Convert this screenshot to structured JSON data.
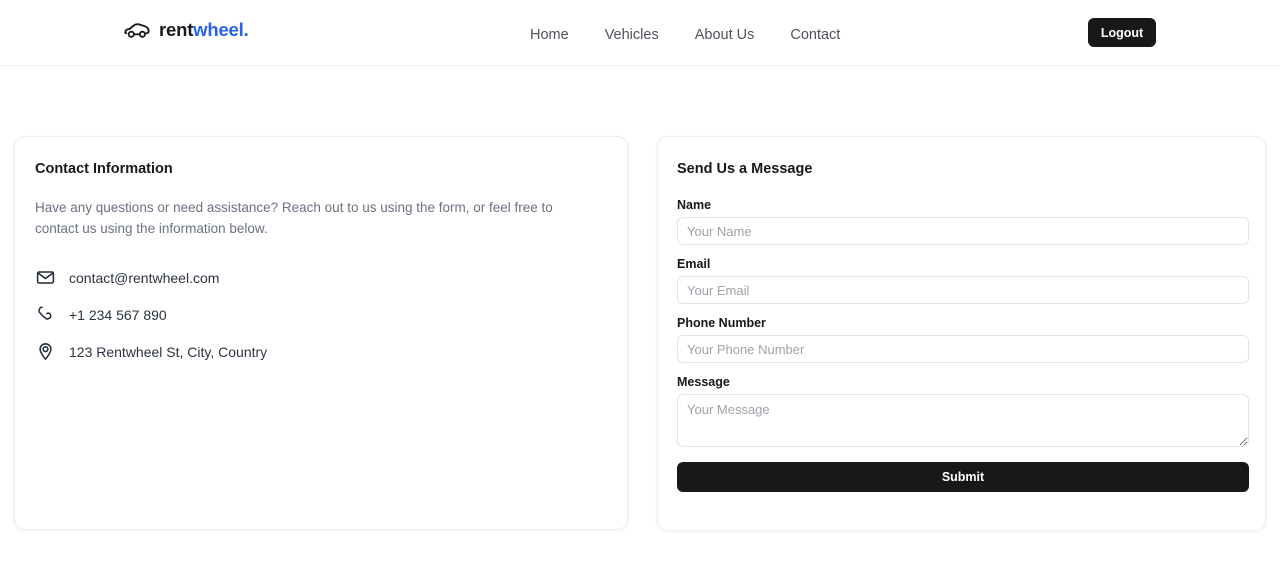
{
  "header": {
    "brand": {
      "icon": "car-icon",
      "text_primary": "rent",
      "text_accent": "wheel.",
      "accent_color": "#2563eb"
    },
    "nav": [
      {
        "label": "Home"
      },
      {
        "label": "Vehicles"
      },
      {
        "label": "About Us"
      },
      {
        "label": "Contact"
      }
    ],
    "logout_label": "Logout"
  },
  "contact_card": {
    "title": "Contact Information",
    "description": "Have any questions or need assistance? Reach out to us using the form, or feel free to contact us using the information below.",
    "details": [
      {
        "icon": "mail-icon",
        "value": "contact@rentwheel.com"
      },
      {
        "icon": "phone-icon",
        "value": "+1 234 567 890"
      },
      {
        "icon": "map-pin-icon",
        "value": "123 Rentwheel St, City, Country"
      }
    ]
  },
  "form_card": {
    "title": "Send Us a Message",
    "fields": [
      {
        "label": "Name",
        "placeholder": "Your Name",
        "value": ""
      },
      {
        "label": "Email",
        "placeholder": "Your Email",
        "value": ""
      },
      {
        "label": "Phone Number",
        "placeholder": "Your Phone Number",
        "value": ""
      },
      {
        "label": "Message",
        "placeholder": "Your Message",
        "value": ""
      }
    ],
    "submit_label": "Submit"
  },
  "theme": {
    "button_dark": "#18181b",
    "border": "#ededed",
    "muted_text": "#6b7280"
  }
}
